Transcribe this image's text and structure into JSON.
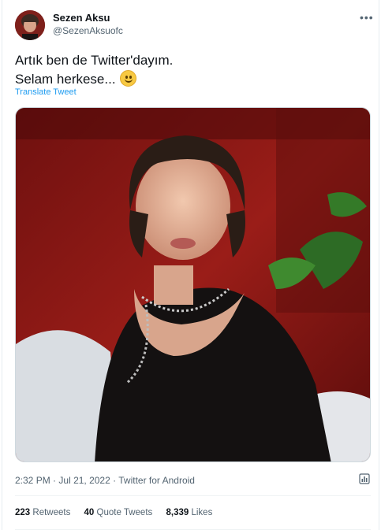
{
  "author": {
    "display_name": "Sezen Aksu",
    "handle": "@SezenAksuofc"
  },
  "tweet": {
    "line1": "Artık ben de Twitter'dayım.",
    "line2": "Selam herkese...",
    "emoji": "slightly-smiling-face",
    "translate_label": "Translate Tweet"
  },
  "meta": {
    "time": "2:32 PM",
    "date": "Jul 21, 2022",
    "source": "Twitter for Android",
    "separator": "·"
  },
  "stats": {
    "retweets_count": "223",
    "retweets_label": "Retweets",
    "quotes_count": "40",
    "quotes_label": "Quote Tweets",
    "likes_count": "8,339",
    "likes_label": "Likes"
  },
  "icons": {
    "more": "more-dots-icon",
    "analytics": "analytics-icon"
  },
  "colors": {
    "link": "#1d9bf0",
    "secondary_text": "#536471",
    "primary_text": "#0f1419",
    "photo_background": "#8e1a17"
  }
}
